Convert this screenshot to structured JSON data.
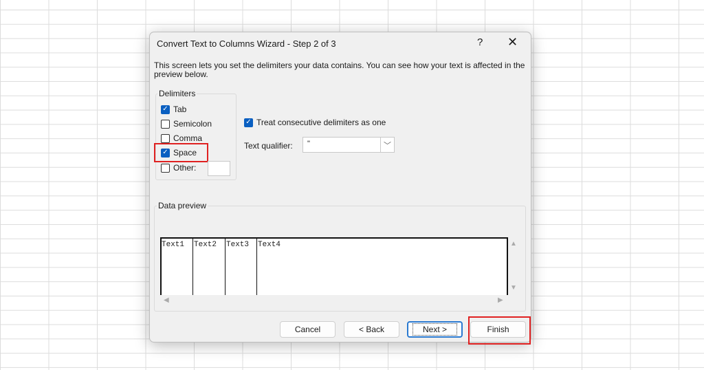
{
  "dialog": {
    "title": "Convert Text to Columns Wizard - Step 2 of 3",
    "help_label": "?",
    "close_label": "✕",
    "description": "This screen lets you set the delimiters your data contains.  You can see how your text is affected in the preview below."
  },
  "delimiters": {
    "group_label": "Delimiters",
    "items": [
      {
        "label": "Tab",
        "checked": true
      },
      {
        "label": "Semicolon",
        "checked": false
      },
      {
        "label": "Comma",
        "checked": false
      },
      {
        "label": "Space",
        "checked": true
      },
      {
        "label": "Other:",
        "checked": false
      }
    ],
    "other_value": ""
  },
  "options": {
    "consecutive_label": "Treat consecutive delimiters as one",
    "consecutive_checked": true,
    "qualifier_label": "Text qualifier:",
    "qualifier_value": "\""
  },
  "preview": {
    "group_label": "Data preview",
    "columns": [
      "Text1",
      "Text2",
      "Text3",
      "Text4"
    ]
  },
  "buttons": {
    "cancel": "Cancel",
    "back": "< Back",
    "next": "Next >",
    "finish": "Finish"
  },
  "colors": {
    "accent": "#0a5fc1",
    "highlight": "#e02020"
  }
}
